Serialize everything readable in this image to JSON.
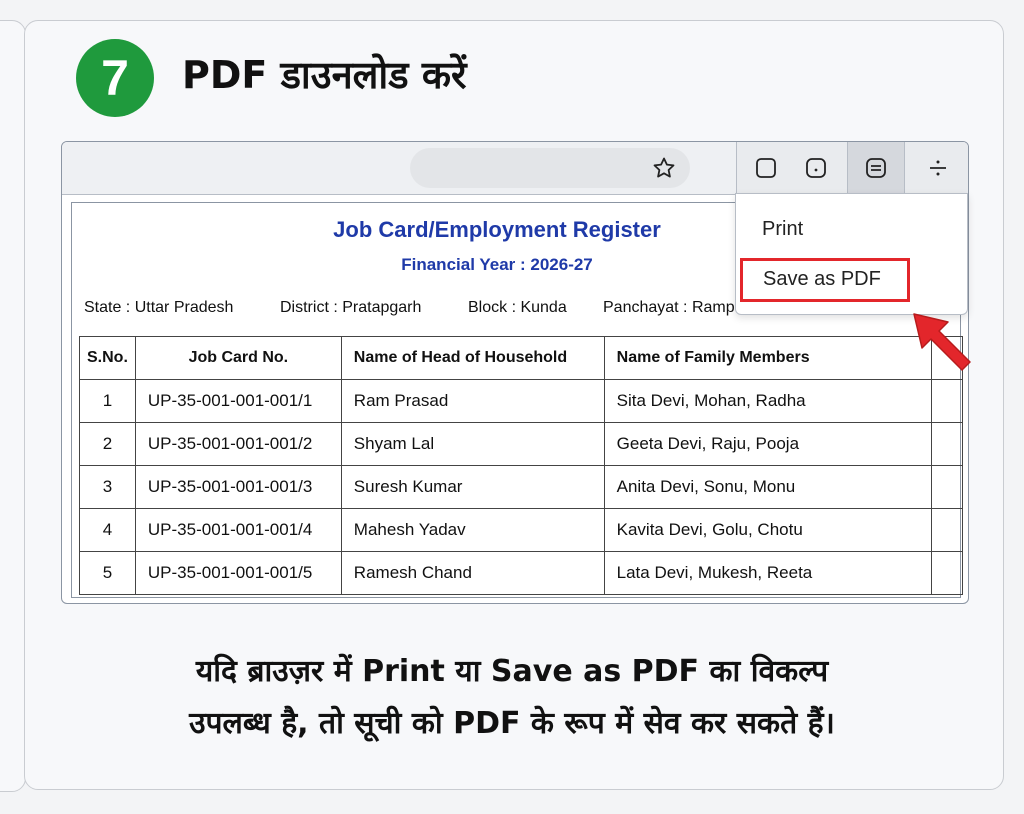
{
  "step": {
    "number": "7",
    "title": "PDF डाउनलोड करें"
  },
  "browser": {
    "toolbar_icons": [
      "square-icon",
      "tab-icon",
      "reader-icon",
      "divide-icon"
    ],
    "menu": {
      "items": [
        "Print",
        "Save as PDF"
      ],
      "highlighted": "Save as PDF",
      "highlight_color": "#e3262b"
    }
  },
  "document": {
    "title": "Job Card/Employment Register",
    "subtitle": "Financial Year : 2026-27",
    "meta": {
      "state": "State : Uttar Pradesh",
      "district": "District : Pratapgarh",
      "block": "Block : Kunda",
      "panchayat": "Panchayat : Ramp"
    },
    "table": {
      "headers": [
        "S.No.",
        "Job Card No.",
        "Name of Head of Household",
        "Name of Family Members"
      ],
      "rows": [
        [
          "1",
          "UP-35-001-001-001/1",
          "Ram Prasad",
          "Sita Devi, Mohan, Radha"
        ],
        [
          "2",
          "UP-35-001-001-001/2",
          "Shyam Lal",
          "Geeta Devi, Raju, Pooja"
        ],
        [
          "3",
          "UP-35-001-001-001/3",
          "Suresh Kumar",
          "Anita Devi, Sonu, Monu"
        ],
        [
          "4",
          "UP-35-001-001-001/4",
          "Mahesh Yadav",
          "Kavita Devi, Golu, Chotu"
        ],
        [
          "5",
          "UP-35-001-001-001/5",
          "Ramesh Chand",
          "Lata Devi, Mukesh, Reeta"
        ]
      ]
    },
    "title_color": "#1f3aa8"
  },
  "instruction": {
    "line1": "यदि ब्राउज़र में Print या Save as PDF का विकल्प",
    "line2": "उपलब्ध है, तो सूची को PDF के रूप में सेव कर सकते हैं।"
  },
  "colors": {
    "badge": "#1f9a3d",
    "arrow": "#e3262b"
  }
}
